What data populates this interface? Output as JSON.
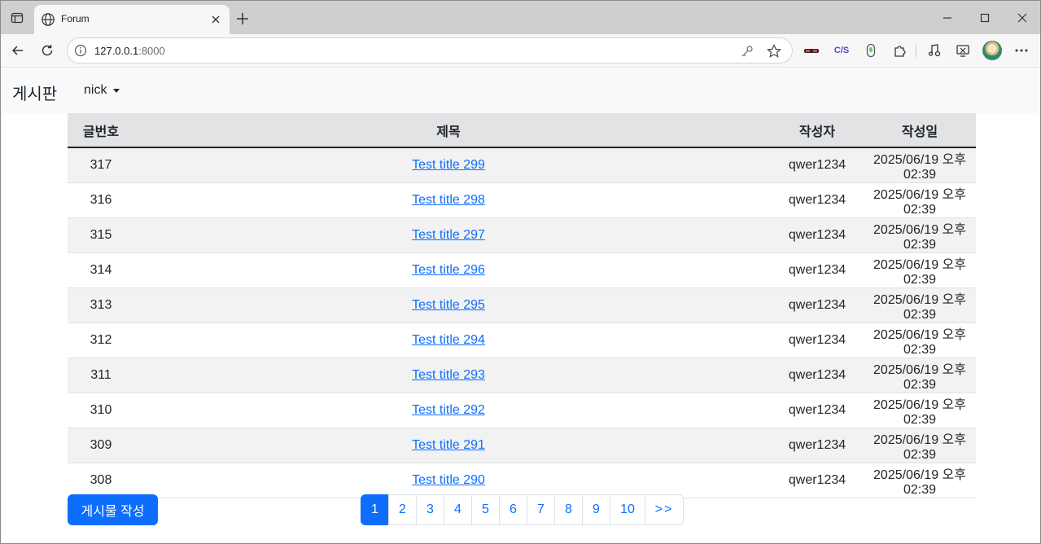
{
  "browser": {
    "tab_title": "Forum",
    "url_host": "127.0.0.1",
    "url_port": ":8000",
    "extensions": [
      "incognito-icon",
      "css-icon",
      "pill-icon",
      "puzzle-icon",
      "media-icon",
      "screenshot-icon"
    ],
    "css_ext_label": "C/S"
  },
  "navbar": {
    "brand": "게시판",
    "user": "nick"
  },
  "table": {
    "headers": {
      "num": "글번호",
      "title": "제목",
      "author": "작성자",
      "date": "작성일"
    },
    "rows": [
      {
        "num": "317",
        "title": "Test title 299",
        "author": "qwer1234",
        "date": "2025/06/19 오후 02:39"
      },
      {
        "num": "316",
        "title": "Test title 298",
        "author": "qwer1234",
        "date": "2025/06/19 오후 02:39"
      },
      {
        "num": "315",
        "title": "Test title 297",
        "author": "qwer1234",
        "date": "2025/06/19 오후 02:39"
      },
      {
        "num": "314",
        "title": "Test title 296",
        "author": "qwer1234",
        "date": "2025/06/19 오후 02:39"
      },
      {
        "num": "313",
        "title": "Test title 295",
        "author": "qwer1234",
        "date": "2025/06/19 오후 02:39"
      },
      {
        "num": "312",
        "title": "Test title 294",
        "author": "qwer1234",
        "date": "2025/06/19 오후 02:39"
      },
      {
        "num": "311",
        "title": "Test title 293",
        "author": "qwer1234",
        "date": "2025/06/19 오후 02:39"
      },
      {
        "num": "310",
        "title": "Test title 292",
        "author": "qwer1234",
        "date": "2025/06/19 오후 02:39"
      },
      {
        "num": "309",
        "title": "Test title 291",
        "author": "qwer1234",
        "date": "2025/06/19 오후 02:39"
      },
      {
        "num": "308",
        "title": "Test title 290",
        "author": "qwer1234",
        "date": "2025/06/19 오후 02:39"
      }
    ]
  },
  "write_button": "게시물 작성",
  "pagination": {
    "pages": [
      "1",
      "2",
      "3",
      "4",
      "5",
      "6",
      "7",
      "8",
      "9",
      "10"
    ],
    "active": "1",
    "next": ">>"
  },
  "colors": {
    "primary": "#0d6efd",
    "header_bg": "#e2e3e5",
    "stripe": "#f2f2f2",
    "navbar_bg": "#f8f9fa"
  }
}
